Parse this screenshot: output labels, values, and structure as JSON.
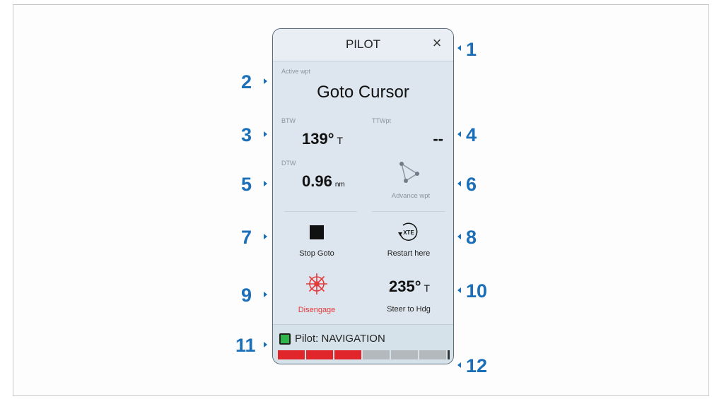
{
  "header": {
    "title": "PILOT",
    "close_label": "×"
  },
  "active_wpt": {
    "label": "Active wpt",
    "value": "Goto Cursor"
  },
  "btw": {
    "label": "BTW",
    "value": "139°",
    "unit": "T"
  },
  "ttwpt": {
    "label": "TTWpt",
    "value": "--"
  },
  "dtw": {
    "label": "DTW",
    "value": "0.96",
    "unit": "nm"
  },
  "advance": {
    "label": "Advance wpt"
  },
  "stop_goto": {
    "label": "Stop Goto"
  },
  "restart": {
    "label": "Restart here",
    "icon_text": "XTE"
  },
  "disengage": {
    "label": "Disengage",
    "color": "#e23a3a"
  },
  "steer": {
    "value": "235°",
    "unit": "T",
    "label": "Steer to Hdg"
  },
  "status": {
    "text": "Pilot: NAVIGATION",
    "led_color": "#2fb54a"
  },
  "rudder_bar": {
    "filled_segments": 3,
    "total_segments": 6,
    "fill_color": "#e0262b",
    "empty_color": "#b4b9bd"
  },
  "callouts": [
    "1",
    "2",
    "3",
    "4",
    "5",
    "6",
    "7",
    "8",
    "9",
    "10",
    "11",
    "12"
  ]
}
